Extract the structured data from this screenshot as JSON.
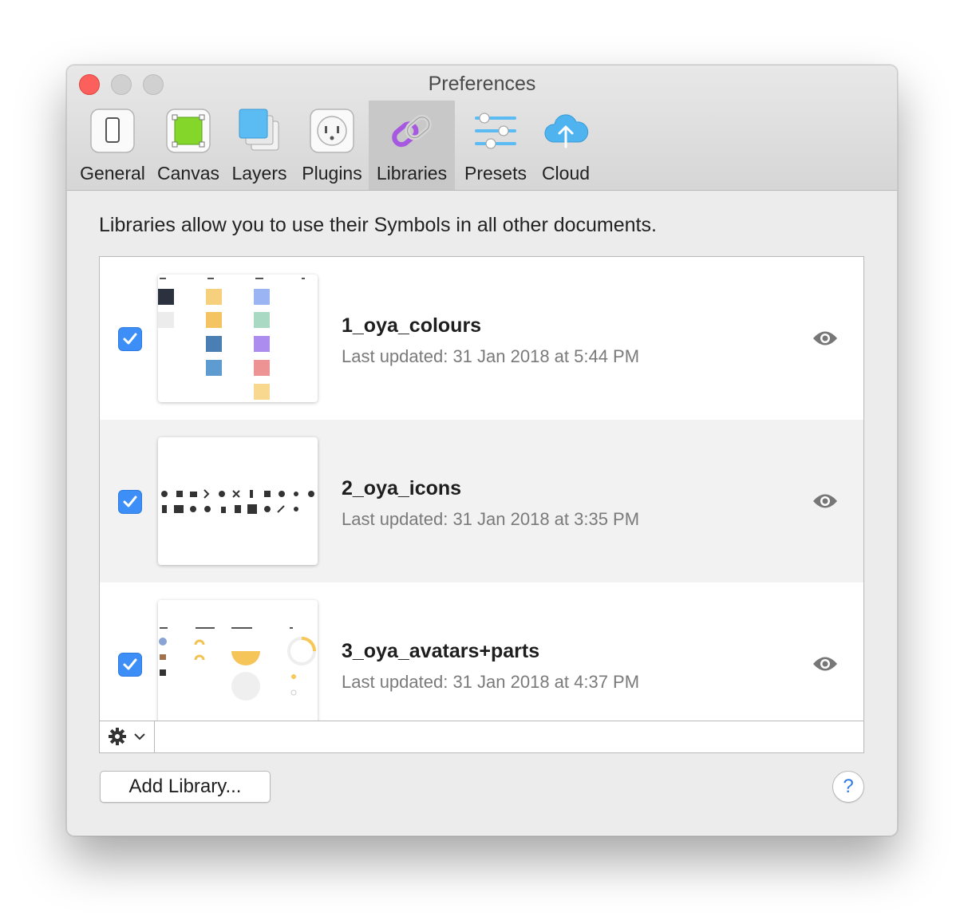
{
  "window": {
    "title": "Preferences"
  },
  "tabs": [
    {
      "label": "General",
      "icon": "general-icon"
    },
    {
      "label": "Canvas",
      "icon": "canvas-icon"
    },
    {
      "label": "Layers",
      "icon": "layers-icon"
    },
    {
      "label": "Plugins",
      "icon": "plugins-icon"
    },
    {
      "label": "Libraries",
      "icon": "libraries-icon",
      "selected": true
    },
    {
      "label": "Presets",
      "icon": "presets-icon"
    },
    {
      "label": "Cloud",
      "icon": "cloud-icon"
    }
  ],
  "description": "Libraries allow you to use their Symbols in all other documents.",
  "libraries": [
    {
      "name": "1_oya_colours",
      "updated": "Last updated: 31 Jan 2018 at 5:44 PM",
      "enabled": true
    },
    {
      "name": "2_oya_icons",
      "updated": "Last updated: 31 Jan 2018 at 3:35 PM",
      "enabled": true
    },
    {
      "name": "3_oya_avatars+parts",
      "updated": "Last updated: 31 Jan 2018 at 4:37 PM",
      "enabled": true
    }
  ],
  "buttons": {
    "add_library": "Add Library...",
    "help": "?"
  },
  "colors": {
    "accent": "#3d8ef7",
    "close": "#fc605c",
    "libraries_icon": "#a659e0",
    "cloud": "#4fb3f0"
  }
}
